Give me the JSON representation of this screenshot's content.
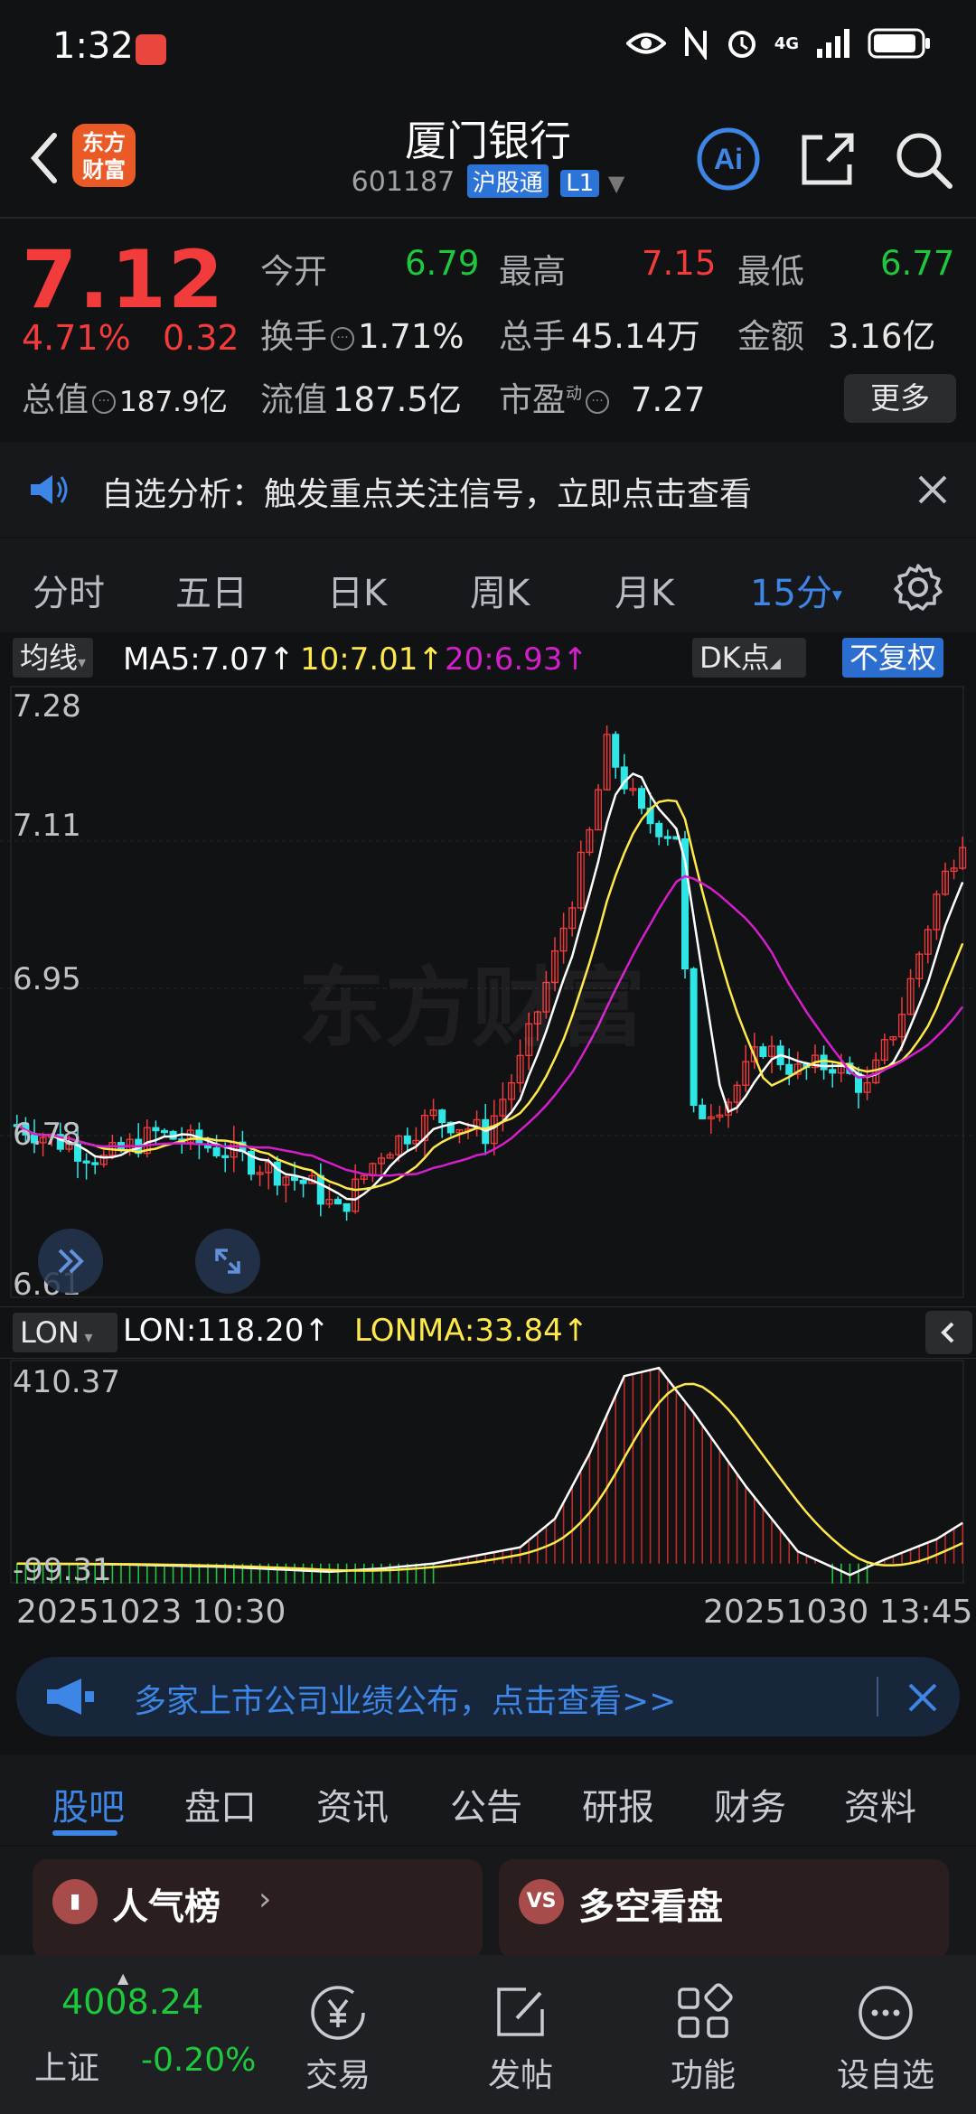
{
  "status_bar": {
    "time": "1:32",
    "network": "4G"
  },
  "header": {
    "title": "厦门银行",
    "code": "601187",
    "tag": "沪股通",
    "level": "L1",
    "logo_text": "东方财富",
    "ai_label": "Ai"
  },
  "quote": {
    "price": "7.12",
    "pct_change": "4.71%",
    "change": "0.32",
    "fields": [
      {
        "label": "今开",
        "value": "6.79"
      },
      {
        "label": "最高",
        "value": "7.15"
      },
      {
        "label": "最低",
        "value": "6.77"
      },
      {
        "label": "换手",
        "value": "1.71%"
      },
      {
        "label": "总手",
        "value": "45.14万"
      },
      {
        "label": "金额",
        "value": "3.16亿"
      },
      {
        "label": "总值",
        "value": "187.9亿"
      },
      {
        "label": "流值",
        "value": "187.5亿"
      },
      {
        "label": "市盈",
        "value": "7.27",
        "sup": "动"
      }
    ],
    "more_label": "更多"
  },
  "notice": {
    "text": "自选分析：触发重点关注信号，立即点击查看"
  },
  "k_tabs": [
    "分时",
    "五日",
    "日K",
    "周K",
    "月K",
    "15分"
  ],
  "indicator_bar": {
    "ma_chip": "均线",
    "ma5": "MA5:7.07↑",
    "ma10": "10:7.01↑",
    "ma20": "20:6.93↑",
    "dk_chip": "DK点",
    "adjust_chip": "不复权"
  },
  "lon_bar": {
    "chip": "LON",
    "lon": "LON:118.20↑",
    "lonma": "LONMA:33.84↑"
  },
  "chart_data": [
    {
      "type": "candlestick",
      "title": "",
      "y_ticks": [
        "7.28",
        "7.11",
        "6.95",
        "6.78",
        "6.61"
      ],
      "ylim": [
        6.61,
        7.28
      ],
      "watermark": "东方财富",
      "series": [
        {
          "name": "MA5",
          "color": "#ffffff"
        },
        {
          "name": "10",
          "color": "#ffe94a"
        },
        {
          "name": "20",
          "color": "#d51ecb"
        }
      ]
    },
    {
      "type": "bar",
      "y_ticks": [
        "410.37",
        "-99.31"
      ],
      "ylim": [
        -99.31,
        410.37
      ],
      "series": [
        {
          "name": "LON",
          "color": "#ffffff"
        },
        {
          "name": "LONMA",
          "color": "#ffe94a"
        }
      ]
    }
  ],
  "date_range": {
    "start": "20251023 10:30",
    "end": "20251030 13:45"
  },
  "promo": {
    "text": "多家上市公司业绩公布，点击查看>>"
  },
  "section_tabs": [
    "股吧",
    "盘口",
    "资讯",
    "公告",
    "研报",
    "财务",
    "资料"
  ],
  "cards": [
    {
      "title": "人气榜",
      "icon": "ranking-icon"
    },
    {
      "title": "多空看盘",
      "icon": "vs-icon",
      "icon_text": "VS"
    }
  ],
  "bottom_nav": {
    "index_value": "4008.24",
    "index_name": "上证",
    "index_change": "-0.20%",
    "items": [
      "交易",
      "发帖",
      "功能",
      "设自选"
    ]
  },
  "colors": {
    "up": "#f23b3b",
    "down": "#1ec83c",
    "accent": "#3d86e6",
    "background": "#111214"
  }
}
